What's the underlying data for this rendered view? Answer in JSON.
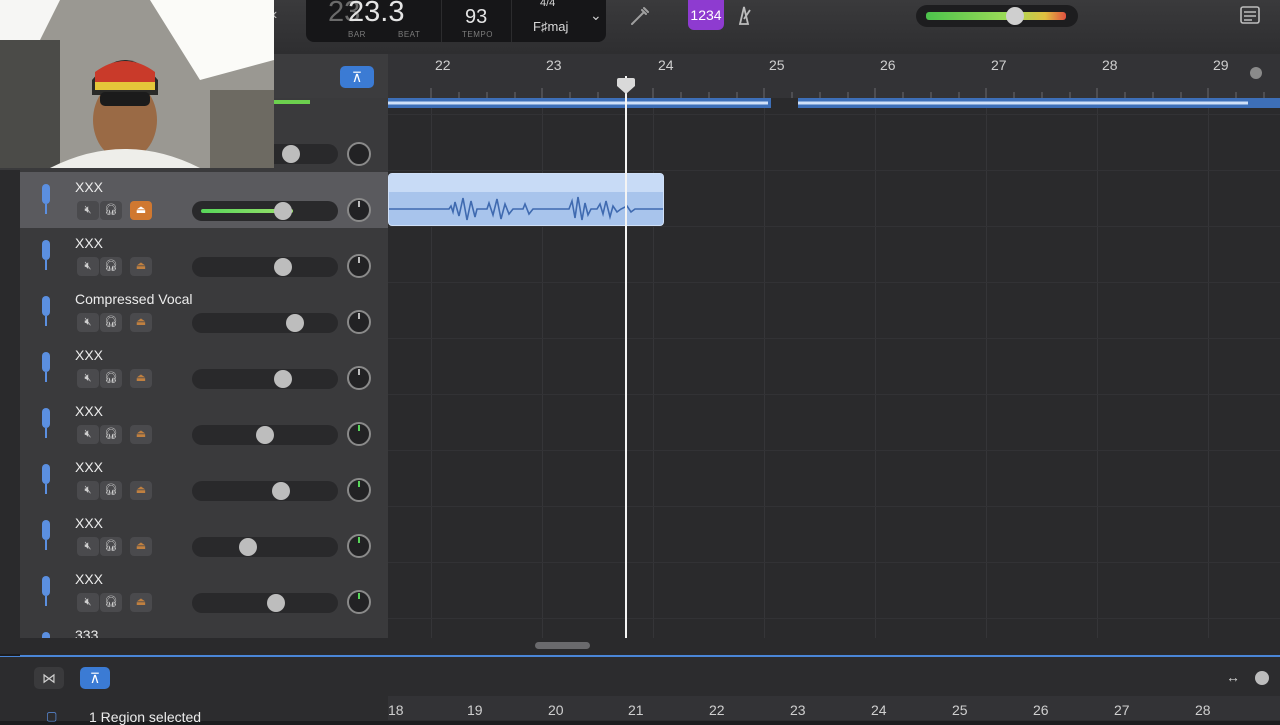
{
  "lcd": {
    "bar": "23",
    "beat": ".3",
    "bar_label": "BAR",
    "beat_label": "BEAT",
    "tempo": "93",
    "tempo_label": "TEMPO",
    "time_signature": "4/4",
    "key": "F♯maj"
  },
  "toolbar": {
    "count_in_label": "1234",
    "count_in_color": "#8e3bd0",
    "metronome_icon": "metronome-icon",
    "tuner_icon": "tuner-icon",
    "master_volume": 0.62,
    "note_pad_icon": "notepad-icon"
  },
  "ruler": {
    "bars": [
      "22",
      "23",
      "24",
      "25",
      "26",
      "27",
      "28",
      "29"
    ]
  },
  "tracks": [
    {
      "name": "XXX",
      "selected": true,
      "volume": 0.62,
      "recording_enabled": true
    },
    {
      "name": "XXX",
      "selected": false,
      "volume": 0.62
    },
    {
      "name": "Compressed Vocal",
      "selected": false,
      "volume": 0.7
    },
    {
      "name": "XXX",
      "selected": false,
      "volume": 0.62
    },
    {
      "name": "XXX",
      "selected": false,
      "volume": 0.5
    },
    {
      "name": "XXX",
      "selected": false,
      "volume": 0.61
    },
    {
      "name": "XXX",
      "selected": false,
      "volume": 0.38
    },
    {
      "name": "XXX",
      "selected": false,
      "volume": 0.57
    },
    {
      "name": "333",
      "selected": false
    }
  ],
  "editor": {
    "status": "1 Region selected",
    "ruler_bars": [
      "18",
      "19",
      "20",
      "21",
      "22",
      "23",
      "24",
      "25",
      "26",
      "27",
      "28"
    ]
  },
  "colors": {
    "accent": "#3b7bd4",
    "region": "#a8c4ec",
    "volume_fill": "#58d65a"
  }
}
